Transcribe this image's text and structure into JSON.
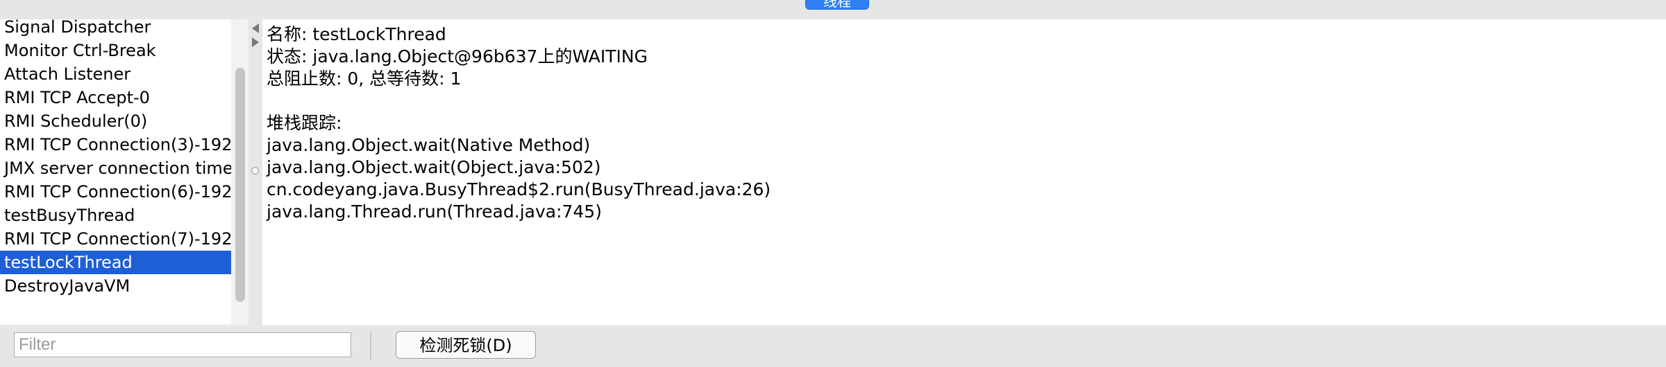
{
  "top_tab_label": "线程",
  "threads": [
    {
      "name": "Signal Dispatcher"
    },
    {
      "name": "Monitor Ctrl-Break"
    },
    {
      "name": "Attach Listener"
    },
    {
      "name": "RMI TCP Accept-0"
    },
    {
      "name": "RMI Scheduler(0)"
    },
    {
      "name": "RMI TCP Connection(3)-192"
    },
    {
      "name": "JMX server connection timeo"
    },
    {
      "name": "RMI TCP Connection(6)-192"
    },
    {
      "name": "testBusyThread"
    },
    {
      "name": "RMI TCP Connection(7)-192"
    },
    {
      "name": "testLockThread",
      "selected": true
    },
    {
      "name": "DestroyJavaVM"
    }
  ],
  "detail": {
    "name_line": "名称: testLockThread",
    "state_line": "状态: java.lang.Object@96b637上的WAITING",
    "counts_line": "总阻止数: 0, 总等待数: 1",
    "stack_header": "堆栈跟踪:",
    "stack": [
      "java.lang.Object.wait(Native Method)",
      "java.lang.Object.wait(Object.java:502)",
      "cn.codeyang.java.BusyThread$2.run(BusyThread.java:26)",
      "java.lang.Thread.run(Thread.java:745)"
    ]
  },
  "filter": {
    "placeholder": "Filter",
    "value": ""
  },
  "buttons": {
    "detect_deadlock": "检测死锁(D)"
  },
  "colors": {
    "selection": "#1f5fd6",
    "accent_tab": "#2f7ff2"
  }
}
